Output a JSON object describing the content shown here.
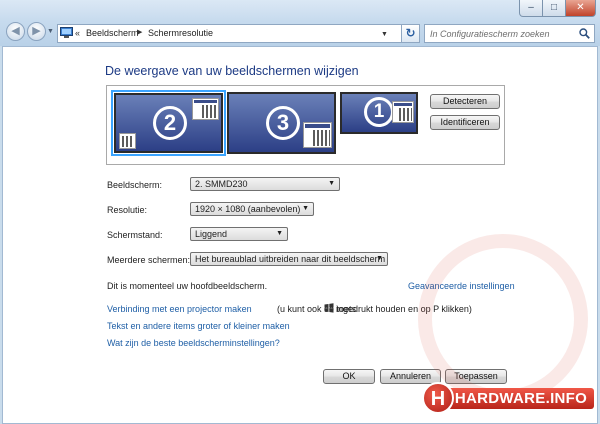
{
  "window": {
    "min_symbol": "–",
    "max_symbol": "□",
    "close_symbol": "✕"
  },
  "nav": {
    "back_symbol": "◀",
    "forward_symbol": "▶",
    "history_symbol": "▼"
  },
  "address": {
    "chevron": "«",
    "crumbs": [
      "Beeldscherm",
      "Schermresolutie"
    ],
    "separator": "▶",
    "dropdown_symbol": "▼",
    "refresh_symbol": "↻"
  },
  "search": {
    "placeholder": "In Configuratiescherm zoeken"
  },
  "main": {
    "title": "De weergave van uw beeldschermen wijzigen",
    "monitors": [
      {
        "number": "2",
        "selected": true
      },
      {
        "number": "3",
        "selected": false
      },
      {
        "number": "1",
        "selected": false
      }
    ],
    "detect_label": "Detecteren",
    "identify_label": "Identificeren",
    "fields": {
      "screen": {
        "label": "Beeldscherm:",
        "value": "2. SMMD230"
      },
      "resolution": {
        "label": "Resolutie:",
        "value": "1920 × 1080 (aanbevolen)"
      },
      "orientation": {
        "label": "Schermstand:",
        "value": "Liggend"
      },
      "multiple": {
        "label": "Meerdere schermen:",
        "value": "Het bureaublad uitbreiden naar dit beeldscherm"
      }
    },
    "combo_arrow": "▼",
    "main_display_text": "Dit is momenteel uw hoofdbeeldscherm.",
    "advanced_link": "Geavanceerde instellingen",
    "projector_link": "Verbinding met een projector maken",
    "projector_hint_a": "(u kunt ook de toets",
    "projector_hint_b": "ingedrukt houden en op P klikken)",
    "text_size_link": "Tekst en andere items groter of kleiner maken",
    "best_settings_link": "Wat zijn de beste beeldscherminstellingen?",
    "ok_label": "OK",
    "cancel_label": "Annuleren",
    "apply_label": "Toepassen"
  },
  "watermark": {
    "h_letter": "H",
    "text": "HARDWARE.INFO"
  },
  "colors": {
    "link": "#1f5fa6",
    "title": "#1c3a84",
    "monitor_top": "#6a80b8",
    "monitor_bottom": "#2c3f86",
    "selection": "#3aa4ff",
    "watermark_red": "#d03a2c"
  }
}
